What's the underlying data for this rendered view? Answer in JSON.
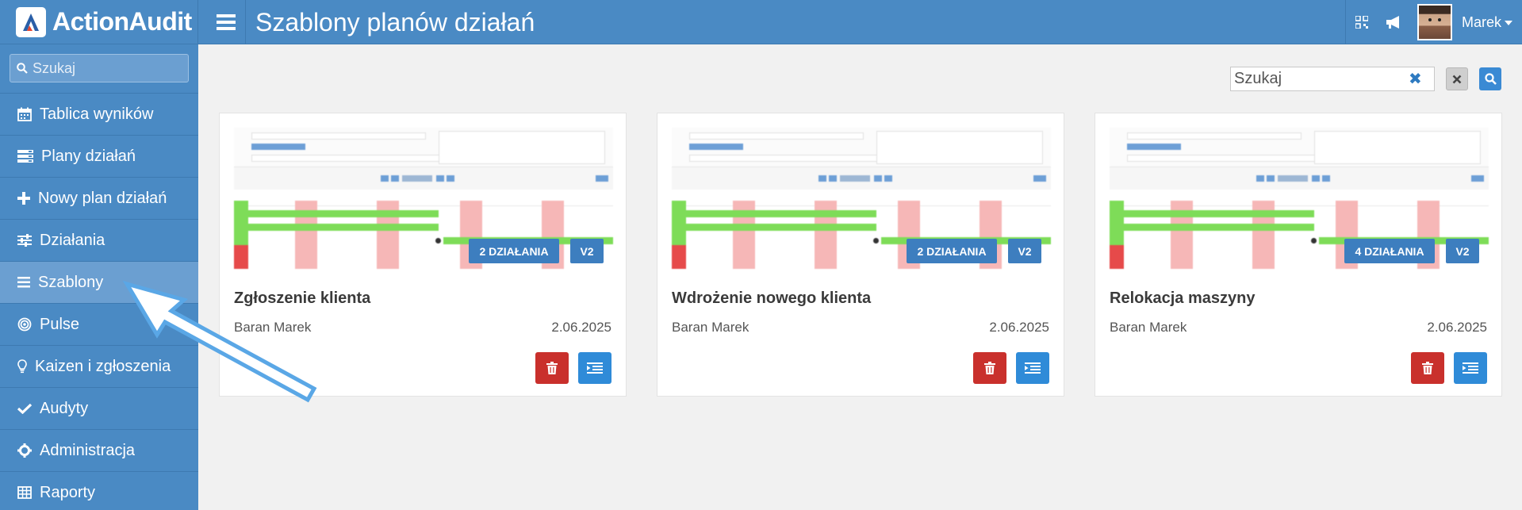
{
  "app": {
    "name": "ActionAudit"
  },
  "header": {
    "title": "Szablony planów działań",
    "user": "Marek"
  },
  "sidebar": {
    "search_placeholder": "Szukaj",
    "items": [
      {
        "label": "Tablica wyników",
        "icon": "calendar-icon"
      },
      {
        "label": "Plany działań",
        "icon": "list-icon"
      },
      {
        "label": "Nowy plan działań",
        "icon": "plus-icon"
      },
      {
        "label": "Działania",
        "icon": "sliders-icon"
      },
      {
        "label": "Szablony",
        "icon": "bars-icon",
        "active": true
      },
      {
        "label": "Pulse",
        "icon": "target-icon"
      },
      {
        "label": "Kaizen i zgłoszenia",
        "icon": "lightbulb-icon"
      },
      {
        "label": "Audyty",
        "icon": "check-icon"
      },
      {
        "label": "Administracja",
        "icon": "gear-icon"
      },
      {
        "label": "Raporty",
        "icon": "table-icon"
      }
    ]
  },
  "main": {
    "search_placeholder": "Szukaj",
    "cards": [
      {
        "title": "Zgłoszenie klienta",
        "author": "Baran Marek",
        "date": "2.06.2025",
        "actions_badge": "2 DZIAŁANIA",
        "version_badge": "V2"
      },
      {
        "title": "Wdrożenie nowego klienta",
        "author": "Baran Marek",
        "date": "2.06.2025",
        "actions_badge": "2 DZIAŁANIA",
        "version_badge": "V2"
      },
      {
        "title": "Relokacja maszyny",
        "author": "Baran Marek",
        "date": "2.06.2025",
        "actions_badge": "4 DZIAŁANIA",
        "version_badge": "V2"
      }
    ]
  },
  "colors": {
    "primary": "#4a8ac4",
    "active_item": "#6b9fd1",
    "badge": "#3d7ebf",
    "delete": "#c9302c",
    "view": "#2f8bd8",
    "arrow": "#5aa7e6"
  }
}
